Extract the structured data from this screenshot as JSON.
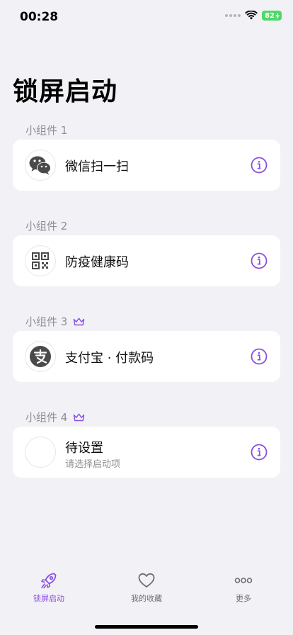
{
  "status": {
    "time": "00:28",
    "battery": "82"
  },
  "page": {
    "title": "锁屏启动"
  },
  "widgets": [
    {
      "label": "小组件 1",
      "premium": false,
      "title": "微信扫一扫",
      "subtitle": "",
      "icon": "wechat-icon"
    },
    {
      "label": "小组件 2",
      "premium": false,
      "title": "防疫健康码",
      "subtitle": "",
      "icon": "qr-code-icon"
    },
    {
      "label": "小组件 3",
      "premium": true,
      "title": "支付宝 · 付款码",
      "subtitle": "",
      "icon": "alipay-icon"
    },
    {
      "label": "小组件 4",
      "premium": true,
      "title": "待设置",
      "subtitle": "请选择启动项",
      "icon": "empty-icon"
    }
  ],
  "tabs": [
    {
      "label": "锁屏启动",
      "icon": "rocket-icon",
      "active": true
    },
    {
      "label": "我的收藏",
      "icon": "heart-icon",
      "active": false
    },
    {
      "label": "更多",
      "icon": "more-dots-icon",
      "active": false
    }
  ],
  "colors": {
    "accent": "#8a4fe0",
    "background": "#f2f1f6",
    "icon_dark": "#4a4a4a"
  }
}
